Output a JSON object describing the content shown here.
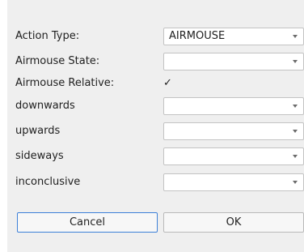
{
  "rows": [
    {
      "label": "Action Type:",
      "value": "AIRMOUSE"
    },
    {
      "label": "Airmouse State:",
      "value": ""
    },
    {
      "label": "Airmouse Relative:",
      "checked": true,
      "check_glyph": "✓"
    },
    {
      "label": "downwards",
      "value": ""
    },
    {
      "label": "upwards",
      "value": ""
    },
    {
      "label": "sideways",
      "value": ""
    },
    {
      "label": "inconclusive",
      "value": ""
    }
  ],
  "buttons": {
    "cancel_label": "Cancel",
    "ok_label": "OK"
  },
  "colors": {
    "dialog_background": "#efefef",
    "focus_border": "#3d80d8"
  }
}
